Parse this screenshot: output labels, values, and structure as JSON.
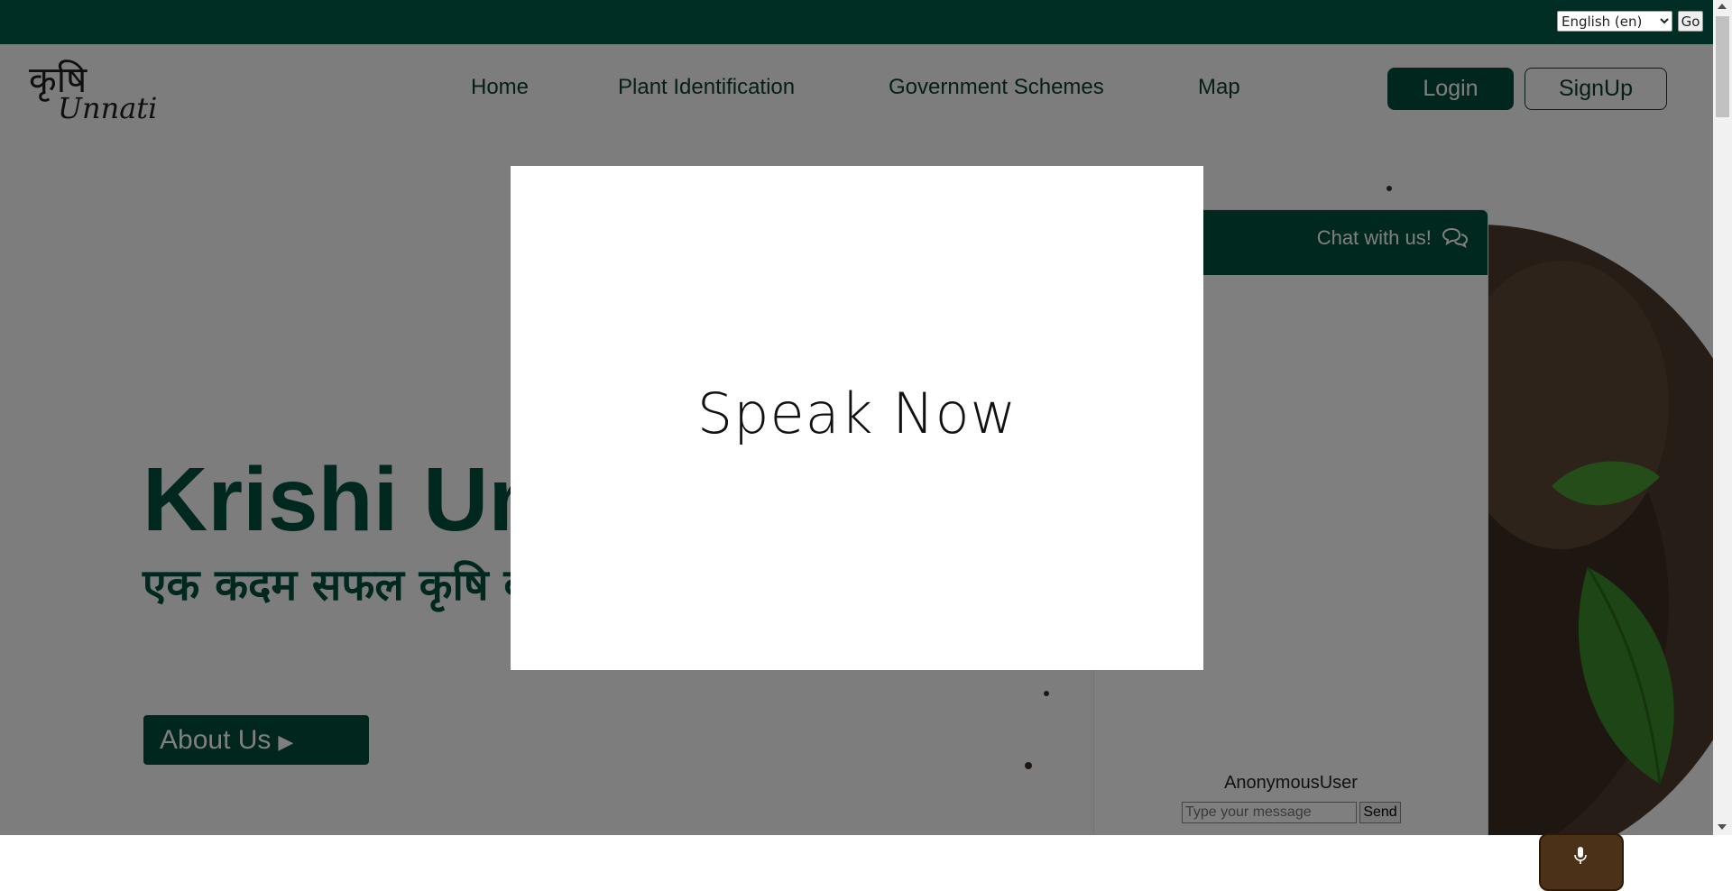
{
  "translate": {
    "language_selected": "English (en)",
    "go_label": "Go"
  },
  "header": {
    "logo_top": "कृषि",
    "logo_bottom": "Unnati",
    "nav": [
      {
        "label": "Home"
      },
      {
        "label": "Plant Identification"
      },
      {
        "label": "Government Schemes"
      },
      {
        "label": "Map"
      }
    ],
    "login_label": "Login",
    "signup_label": "SignUp"
  },
  "hero": {
    "title": "Krishi Unnati",
    "subtitle": "एक कदम सफल कृषि की ओर",
    "about_label": "About Us"
  },
  "chat": {
    "header_label": "Chat with us!",
    "user_name": "AnonymousUser",
    "input_placeholder": "Type your message",
    "send_label": "Send"
  },
  "modal": {
    "text": "Speak Now"
  },
  "colors": {
    "brand_dark": "#012e24",
    "brand_green": "#014d3a",
    "mic_brown": "#4a3117",
    "overlay": "rgba(0,0,0,0.5)"
  },
  "icons": {
    "chat": "chat-bubbles-icon",
    "about_caret": "caret-right-icon",
    "mic": "microphone-icon"
  }
}
